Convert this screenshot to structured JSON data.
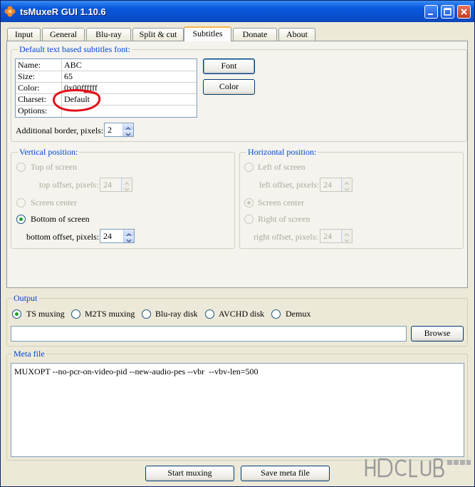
{
  "window": {
    "title": "tsMuxeR GUI 1.10.6"
  },
  "tabs": [
    "Input",
    "General",
    "Blu-ray",
    "Split & cut",
    "Subtitles",
    "Donate",
    "About"
  ],
  "font_group": {
    "legend": "Default text based subtitles font:",
    "rows": [
      {
        "key": "Name:",
        "value": "ABC"
      },
      {
        "key": "Size:",
        "value": "65"
      },
      {
        "key": "Color:",
        "value": "0x00ffffff"
      },
      {
        "key": "Charset:",
        "value": "Default"
      },
      {
        "key": "Options:",
        "value": ""
      }
    ],
    "font_button": "Font",
    "color_button": "Color",
    "border_label": "Additional border, pixels:",
    "border_value": "2"
  },
  "vertical": {
    "legend": "Vertical position:",
    "top": "Top of screen",
    "top_offset_label": "top offset, pixels:",
    "top_offset_value": "24",
    "center": "Screen center",
    "bottom": "Bottom of screen",
    "bottom_offset_label": "bottom offset, pixels:",
    "bottom_offset_value": "24"
  },
  "horizontal": {
    "legend": "Horizontal position:",
    "left": "Left of screen",
    "left_offset_label": "left offset, pixels:",
    "left_offset_value": "24",
    "center": "Screen center",
    "right": "Right of screen",
    "right_offset_label": "right offset, pixels:",
    "right_offset_value": "24"
  },
  "output": {
    "legend": "Output",
    "options": [
      "TS muxing",
      "M2TS muxing",
      "Blu-ray disk",
      "AVCHD disk",
      "Demux"
    ],
    "path": "",
    "browse": "Browse"
  },
  "meta": {
    "legend": "Meta file",
    "text": "MUXOPT --no-pcr-on-video-pid --new-audio-pes --vbr  --vbv-len=500"
  },
  "buttons": {
    "start": "Start muxing",
    "save": "Save meta file"
  },
  "colors": {
    "titlebar": "#0a50d0",
    "accent_legend": "#0046d5",
    "annotation": "#e0101a"
  }
}
